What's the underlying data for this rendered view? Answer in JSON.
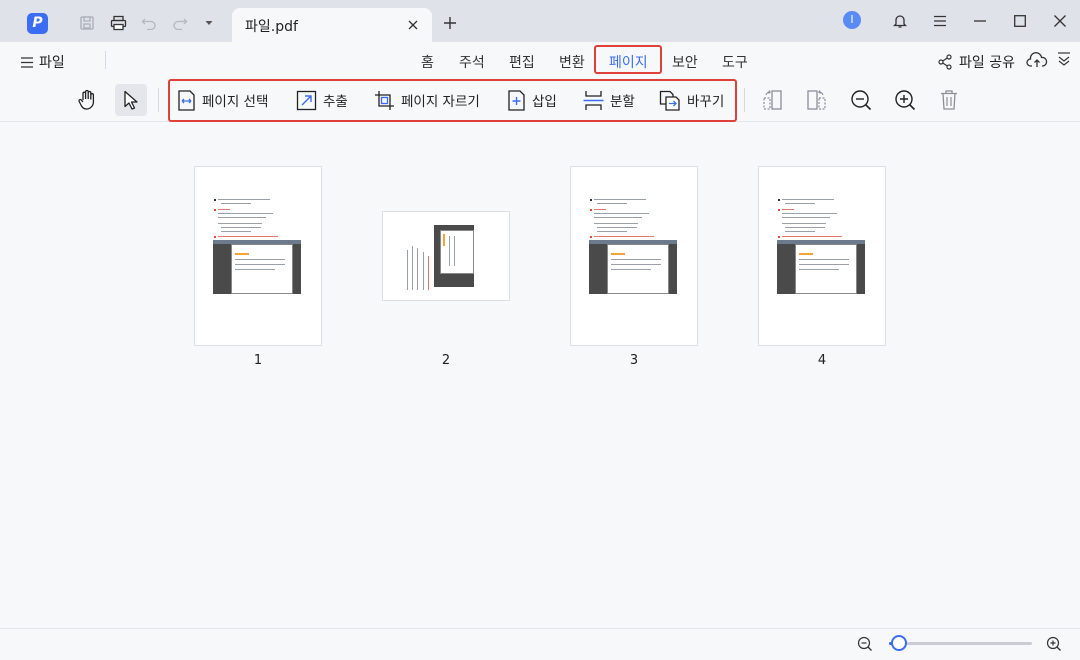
{
  "titlebar": {
    "app_logo": "P",
    "tab_title": "파일.pdf",
    "user_initial": "I"
  },
  "menubar": {
    "file_label": "파일",
    "tabs": [
      {
        "label": "홈"
      },
      {
        "label": "주석"
      },
      {
        "label": "편집"
      },
      {
        "label": "변환"
      },
      {
        "label": "페이지"
      },
      {
        "label": "보안"
      },
      {
        "label": "도구"
      }
    ],
    "active_tab": "페이지",
    "share_label": "파일 공유"
  },
  "page_tools": [
    {
      "label": "페이지 선택",
      "icon": "page-select-icon"
    },
    {
      "label": "추출",
      "icon": "extract-icon"
    },
    {
      "label": "페이지 자르기",
      "icon": "crop-icon"
    },
    {
      "label": "삽입",
      "icon": "insert-icon"
    },
    {
      "label": "분할",
      "icon": "split-icon"
    },
    {
      "label": "바꾸기",
      "icon": "replace-icon"
    }
  ],
  "pages": [
    {
      "number": "1"
    },
    {
      "number": "2"
    },
    {
      "number": "3"
    },
    {
      "number": "4"
    }
  ],
  "zoom": {
    "level_fraction": 0.07
  },
  "colors": {
    "accent": "#3b6cf6",
    "highlight": "#e0403a"
  }
}
